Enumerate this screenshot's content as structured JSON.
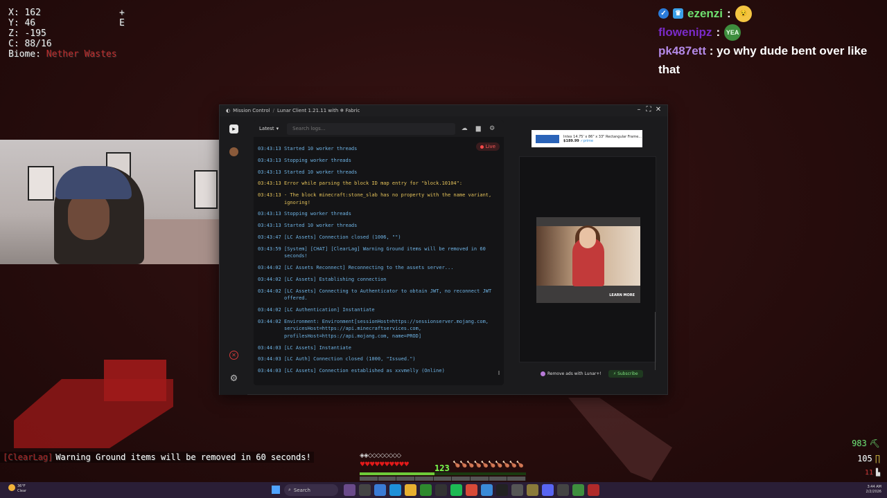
{
  "game_hud": {
    "x": "X: 162",
    "y": "Y: 46",
    "z": "Z: -195",
    "c": "C: 88/16",
    "biome_label": "Biome:",
    "biome_value": "Nether Wastes",
    "plus": "+",
    "direction": "E"
  },
  "chat": [
    {
      "user": "ezenzi",
      "sep": " :",
      "user_color": "#6fe06f",
      "emote": "😵"
    },
    {
      "user": "flowenipz",
      "sep": " :",
      "user_color": "#7a2ac8",
      "emote": "YEA"
    },
    {
      "user": "pk487ett",
      "sep": " :",
      "user_color": "#b58ae8",
      "message": "yo why dude bent over like that"
    }
  ],
  "window": {
    "breadcrumb_root": "Mission Control",
    "breadcrumb_sep": "/",
    "breadcrumb_current": "Lunar Client 1.21.11 with ❄ Fabric"
  },
  "logs": {
    "filter_label": "Latest",
    "search_placeholder": "Search logs...",
    "live_label": "Live",
    "entries": [
      {
        "ts": "03:43:13",
        "msg": "Started 10 worker threads",
        "level": "info"
      },
      {
        "ts": "03:43:13",
        "msg": "Stopping worker threads",
        "level": "info"
      },
      {
        "ts": "03:43:13",
        "msg": "Started 10 worker threads",
        "level": "info"
      },
      {
        "ts": "03:43:13",
        "msg": "Error while parsing the block ID map entry for \"block.10104\":",
        "level": "warn"
      },
      {
        "ts": "03:43:13",
        "msg": "- The block minecraft:stone_slab has no property with the name variant, ignoring!",
        "level": "warn"
      },
      {
        "ts": "03:43:13",
        "msg": "Stopping worker threads",
        "level": "info"
      },
      {
        "ts": "03:43:13",
        "msg": "Started 10 worker threads",
        "level": "info"
      },
      {
        "ts": "03:43:47",
        "msg": "[LC Assets] Connection closed (1006, \"\")",
        "level": "info"
      },
      {
        "ts": "03:43:59",
        "msg": "[System] [CHAT] [ClearLag] Warning Ground items will be removed in 60 seconds!",
        "level": "info"
      },
      {
        "ts": "03:44:02",
        "msg": "[LC Assets Reconnect] Reconnecting to the assets server...",
        "level": "info"
      },
      {
        "ts": "03:44:02",
        "msg": "[LC Assets] Establishing connection",
        "level": "info"
      },
      {
        "ts": "03:44:02",
        "msg": "[LC Assets] Connecting to Authenticator to obtain JWT, no reconnect JWT offered.",
        "level": "info"
      },
      {
        "ts": "03:44:02",
        "msg": "[LC Authentication] Instantiate",
        "level": "info"
      },
      {
        "ts": "03:44:02",
        "msg": "Environment: Environment[sessionHost=https://sessionserver.mojang.com, servicesHost=https://api.minecraftservices.com, profilesHost=https://api.mojang.com, name=PROD]",
        "level": "info"
      },
      {
        "ts": "03:44:03",
        "msg": "[LC Assets] Instantiate",
        "level": "info"
      },
      {
        "ts": "03:44:03",
        "msg": "[LC Auth] Connection closed (1000, \"Issued.\")",
        "level": "info"
      },
      {
        "ts": "03:44:03",
        "msg": "[LC Assets] Connection established as xxvmelly (Online)",
        "level": "info"
      }
    ]
  },
  "ads": {
    "banner_title": "Intex 14.75' x 86\" x 33\" Rectangular Frame...",
    "banner_price": "$189.99",
    "banner_prime": "✓prime",
    "learn_more": "LEARN MORE",
    "remove_ads": "Remove ads with Lunar+!",
    "subscribe": "Subscribe"
  },
  "mc": {
    "chat_tag": "[ClearLag]",
    "chat_msg": "Warning Ground items will be removed in 60 seconds!",
    "armor": "◈◈◇◇◇◇◇◇◇◇",
    "hearts": "♥♥♥♥♥♥♥♥♥♥",
    "food": "🍗🍗🍗🍗🍗🍗🍗🍗🍗🍗",
    "level": "123",
    "xp_fraction": 0.45,
    "side1": "983",
    "side2": "105",
    "side3": "11"
  },
  "taskbar": {
    "temp": "36°F",
    "condition": "Clear",
    "search_label": "Search",
    "time": "3:44 AM",
    "date": "2/2/2026"
  }
}
